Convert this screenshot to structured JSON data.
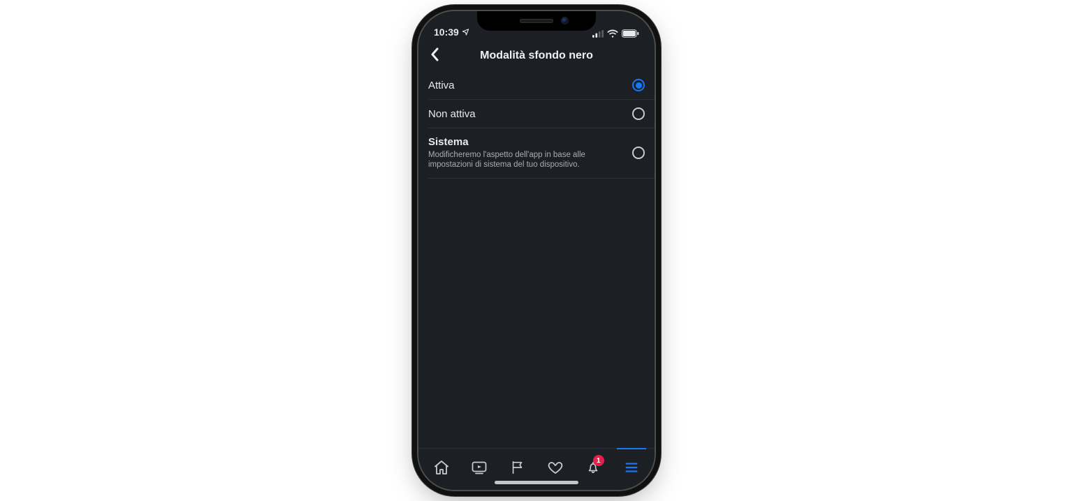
{
  "statusbar": {
    "time": "10:39"
  },
  "header": {
    "title": "Modalità sfondo nero"
  },
  "options": [
    {
      "title": "Attiva",
      "subtitle": "",
      "selected": true
    },
    {
      "title": "Non attiva",
      "subtitle": "",
      "selected": false
    },
    {
      "title": "Sistema",
      "subtitle": "Modificheremo l'aspetto dell'app in base alle impostazioni di sistema del tuo dispositivo.",
      "selected": false
    }
  ],
  "tabbar": {
    "notifications_badge": "1"
  }
}
